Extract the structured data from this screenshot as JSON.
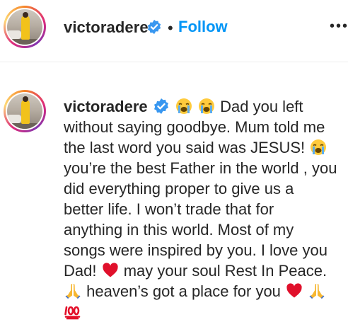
{
  "header": {
    "username": "victoradere",
    "separator": "•",
    "follow_label": "Follow",
    "more_label": "•••"
  },
  "caption": {
    "username": "victoradere",
    "line1": "Dad you left",
    "line2": "without saying goodbye. Mum told me",
    "line3": "the last word you said was JESUS!",
    "line4": "you’re the best Father in the world , you",
    "line5": "did everything proper to give us a",
    "line6": "better life. I won’t trade that for",
    "line7": "anything in this world. Most of my",
    "line8": "songs were inspired by you. I love you",
    "line9": "Dad!",
    "line9b": "may your soul Rest In Peace.",
    "line10": "heaven’s got a place for you"
  },
  "icons": {
    "verified": "verified-badge-icon",
    "crying": "loudly-crying-face-emoji",
    "heart": "red-heart-emoji",
    "pray": "folded-hands-emoji",
    "hundred": "hundred-points-emoji"
  },
  "colors": {
    "text": "#262626",
    "follow": "#0095f6",
    "verified": "#3897f0",
    "heart": "#e0102b"
  }
}
